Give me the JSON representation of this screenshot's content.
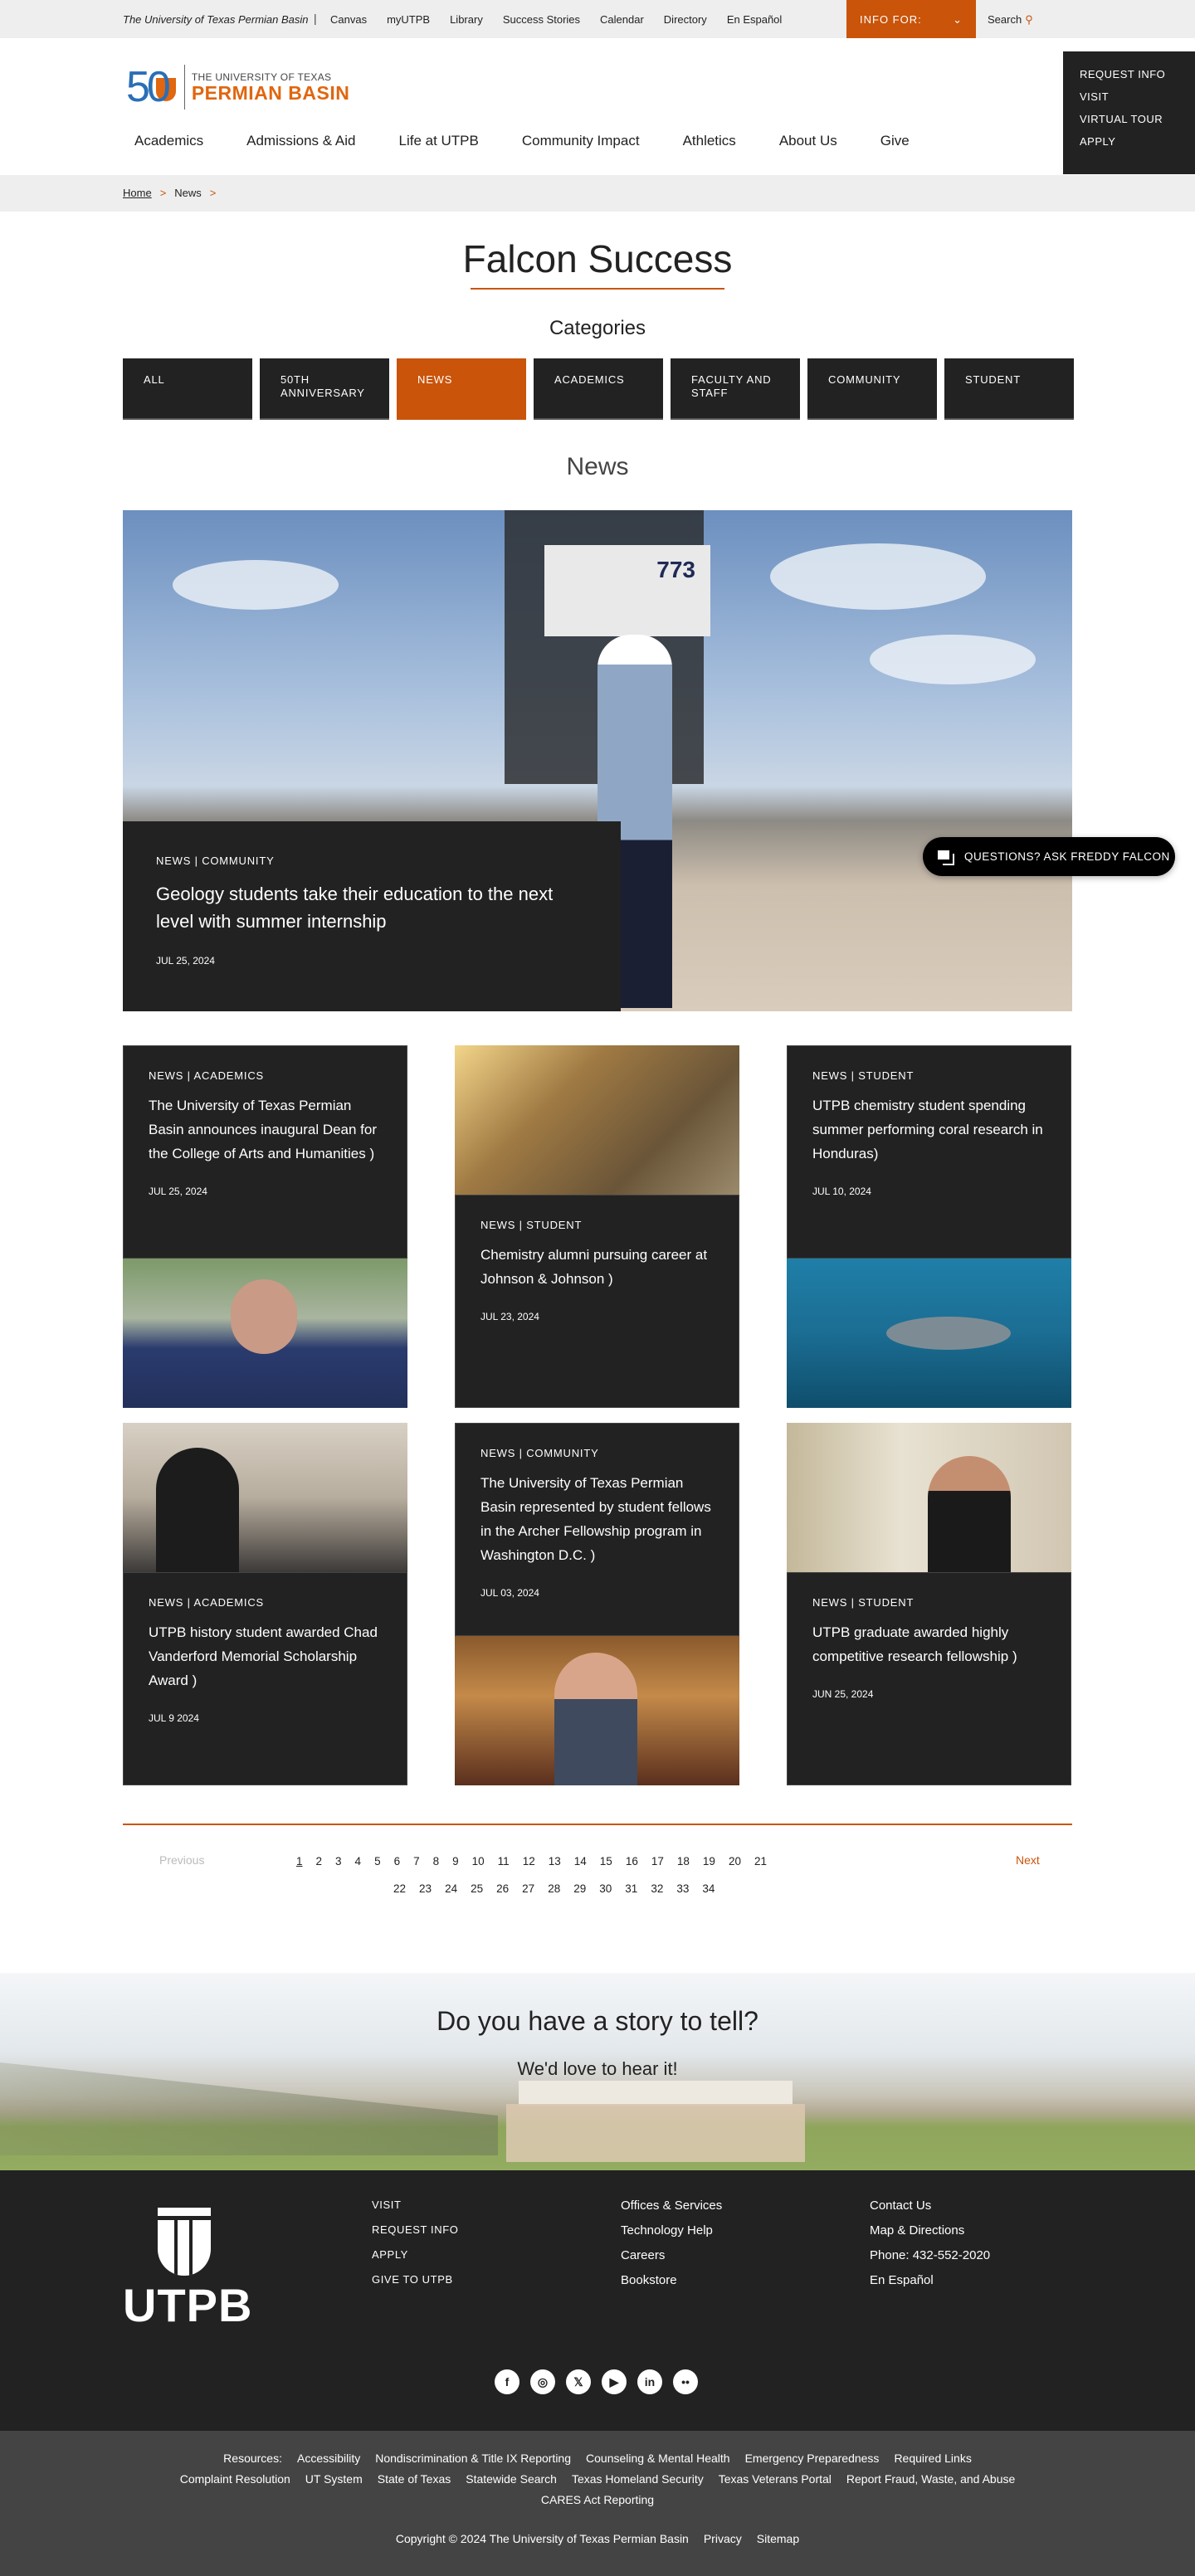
{
  "utility_bar": {
    "site_name": "The University of Texas Permian Basin",
    "separator": "|",
    "links": [
      "Canvas",
      "myUTPB",
      "Library",
      "Success Stories",
      "Calendar",
      "Directory",
      "En Español"
    ],
    "info_for_label": "INFO FOR:",
    "info_for_icon": "chevron-down-icon",
    "search_label": "Search",
    "search_icon": "search-icon"
  },
  "logo": {
    "anniversary": "50",
    "line1": "THE UNIVERSITY OF TEXAS",
    "line2": "PERMIAN BASIN"
  },
  "main_nav": [
    "Academics",
    "Admissions & Aid",
    "Life at UTPB",
    "Community Impact",
    "Athletics",
    "About Us",
    "Give"
  ],
  "quick_links": [
    "REQUEST INFO",
    "VISIT",
    "VIRTUAL TOUR",
    "APPLY"
  ],
  "breadcrumb": {
    "home": "Home",
    "current": "News",
    "separator": ">"
  },
  "page_title": "Falcon Success",
  "categories": {
    "heading": "Categories",
    "items": [
      {
        "label": "ALL",
        "active": false
      },
      {
        "label": "50TH ANNIVERSARY",
        "active": false
      },
      {
        "label": "NEWS",
        "active": true
      },
      {
        "label": "ACADEMICS",
        "active": false
      },
      {
        "label": "FACULTY AND STAFF",
        "active": false
      },
      {
        "label": "COMMUNITY",
        "active": false
      },
      {
        "label": "STUDENT",
        "active": false
      }
    ]
  },
  "section_heading": "News",
  "featured": {
    "tag": "NEWS | COMMUNITY",
    "headline": "Geology students take their education to the next level with summer internship",
    "date": "JUL 25, 2024",
    "image_alt": "Student in hard hat in front of drilling rig 773"
  },
  "chat_button": {
    "label": "QUESTIONS? ASK FREDDY FALCON",
    "icon": "chat-icon"
  },
  "articles": [
    {
      "tag": "NEWS | ACADEMICS",
      "headline": "The University of Texas Permian Basin announces inaugural Dean for the College of Arts and Humanities )",
      "date": "JUL 25, 2024",
      "image": "portrait-man-glasses"
    },
    {
      "tag": "NEWS | STUDENT",
      "headline": "Chemistry alumni pursuing career at Johnson & Johnson )",
      "date": "JUL 23, 2024",
      "image": "alumna-at-johnson-sign"
    },
    {
      "tag": "NEWS | STUDENT",
      "headline": "UTPB chemistry student spending summer performing coral research in Honduras)",
      "date": "JUL 10, 2024",
      "image": "underwater-shark"
    },
    {
      "tag": "NEWS | ACADEMICS",
      "headline": "UTPB history student awarded Chad Vanderford Memorial Scholarship Award )",
      "date": "JUL 9 2024",
      "image": "student-at-desk"
    },
    {
      "tag": "NEWS | COMMUNITY",
      "headline": "The University of Texas Permian Basin represented by student fellows in the Archer Fellowship program in Washington D.C. )",
      "date": "JUL 03, 2024",
      "image": "portrait-man-suit"
    },
    {
      "tag": "NEWS | STUDENT",
      "headline": "UTPB graduate awarded highly competitive research fellowship )",
      "date": "JUN 25, 2024",
      "image": "student-poster"
    }
  ],
  "pagination": {
    "previous": "Previous",
    "next": "Next",
    "current": "1",
    "row1": [
      "1",
      "2",
      "3",
      "4",
      "5",
      "6",
      "7",
      "8",
      "9",
      "10",
      "11",
      "12",
      "13",
      "14",
      "15",
      "16",
      "17",
      "18",
      "19",
      "20",
      "21"
    ],
    "row2": [
      "22",
      "23",
      "24",
      "25",
      "26",
      "27",
      "28",
      "29",
      "30",
      "31",
      "32",
      "33",
      "34"
    ]
  },
  "story": {
    "heading": "Do you have a story to tell?",
    "subheading": "We'd love to hear it!"
  },
  "footer": {
    "logo_text": "UTPB",
    "col1": [
      "VISIT",
      "REQUEST INFO",
      "APPLY",
      "GIVE TO UTPB"
    ],
    "col2": [
      "Offices & Services",
      "Technology Help",
      "Careers",
      "Bookstore"
    ],
    "col3": [
      "Contact Us",
      "Map & Directions",
      "Phone: 432-552-2020",
      "En Español"
    ],
    "social": [
      {
        "name": "facebook-icon",
        "glyph": "f"
      },
      {
        "name": "instagram-icon",
        "glyph": "◎"
      },
      {
        "name": "x-icon",
        "glyph": "𝕏"
      },
      {
        "name": "youtube-icon",
        "glyph": "▶"
      },
      {
        "name": "linkedin-icon",
        "glyph": "in"
      },
      {
        "name": "flickr-icon",
        "glyph": "••"
      }
    ]
  },
  "bottom_bar": {
    "resources_label": "Resources:",
    "row1": [
      "Accessibility",
      "Nondiscrimination & Title IX Reporting",
      "Counseling & Mental Health",
      "Emergency Preparedness",
      "Required Links"
    ],
    "row2": [
      "Complaint Resolution",
      "UT System",
      "State of Texas",
      "Statewide Search",
      "Texas Homeland Security",
      "Texas Veterans Portal",
      "Report Fraud, Waste, and Abuse"
    ],
    "row3": [
      "CARES Act Reporting"
    ],
    "copyright": "Copyright © 2024 The University of Texas Permian Basin",
    "legal": [
      "Privacy",
      "Sitemap"
    ]
  }
}
